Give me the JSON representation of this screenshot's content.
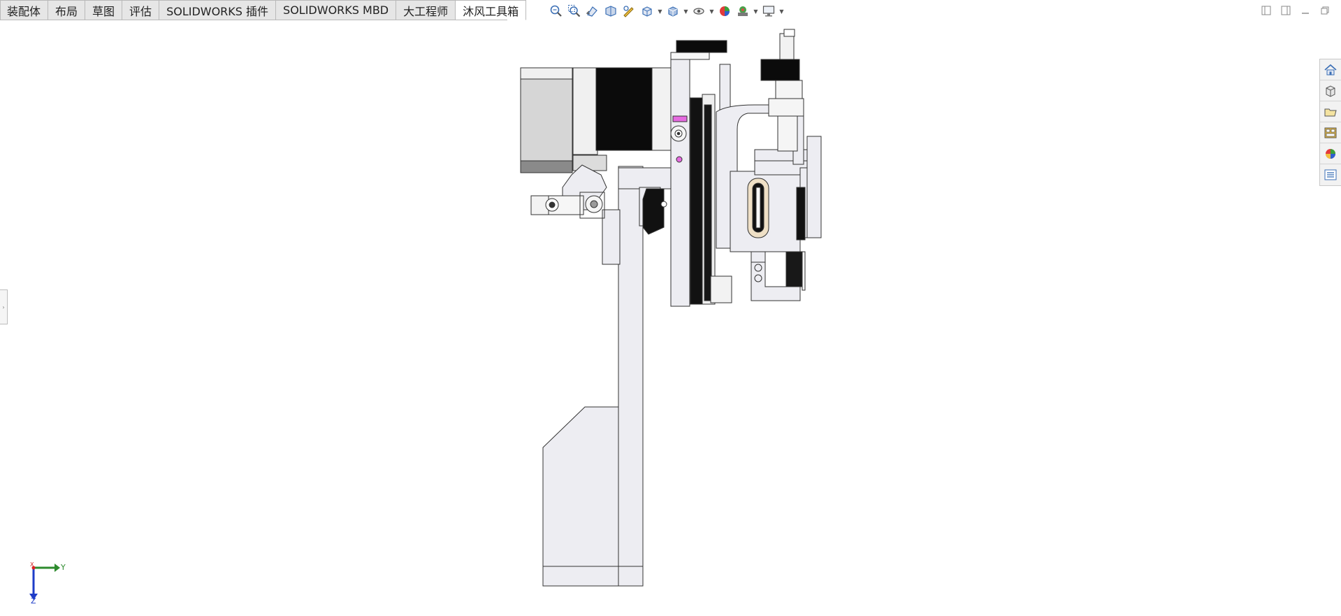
{
  "tabs": [
    {
      "label": "装配体",
      "active": false
    },
    {
      "label": "布局",
      "active": false
    },
    {
      "label": "草图",
      "active": false
    },
    {
      "label": "评估",
      "active": false
    },
    {
      "label": "SOLIDWORKS 插件",
      "active": false
    },
    {
      "label": "SOLIDWORKS MBD",
      "active": false
    },
    {
      "label": "大工程师",
      "active": false
    },
    {
      "label": "沐风工具箱",
      "active": true
    }
  ],
  "hud_icons": [
    "zoom-to-fit-icon",
    "zoom-to-area-icon",
    "previous-view-icon",
    "section-view-icon",
    "dynamic-annotation-icon",
    "view-orientation-icon",
    "display-style-icon",
    "hide-show-items-icon",
    "edit-appearance-icon",
    "apply-scene-icon",
    "view-settings-icon"
  ],
  "taskpane_icons": [
    "solidworks-resources-icon",
    "design-library-icon",
    "file-explorer-icon",
    "view-palette-icon",
    "appearances-icon",
    "custom-properties-icon"
  ],
  "triad": {
    "y_label": "Y",
    "z_label": "Z",
    "x_label": "X"
  },
  "colors": {
    "tab_bg": "#e6e6e6",
    "tab_active": "#ffffff",
    "part_fill": "#ededf2",
    "part_edge": "#333333",
    "accent_pink": "#e56ae0",
    "y_axis": "#2e8b2e",
    "z_axis": "#1e3cc8"
  }
}
